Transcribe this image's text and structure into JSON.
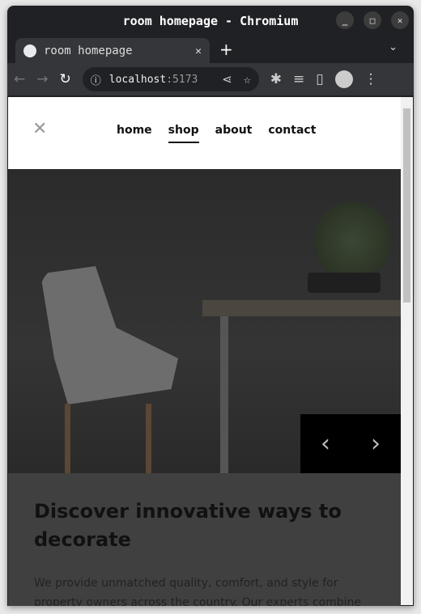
{
  "window": {
    "title": "room homepage - Chromium"
  },
  "tab": {
    "title": "room homepage",
    "close": "✕",
    "new_tab": "+",
    "menu": "⌄"
  },
  "toolbar": {
    "url_host": "localhost",
    "url_port": ":5173"
  },
  "nav": {
    "close_icon": "✕",
    "links": [
      {
        "label": "home"
      },
      {
        "label": "shop",
        "active": true
      },
      {
        "label": "about"
      },
      {
        "label": "contact"
      }
    ]
  },
  "hero": {
    "prev": "‹",
    "next": "›"
  },
  "content": {
    "heading": "Discover innovative ways to decorate",
    "body": "We provide unmatched quality, comfort, and style for property owners across the country. Our experts combine form and"
  }
}
